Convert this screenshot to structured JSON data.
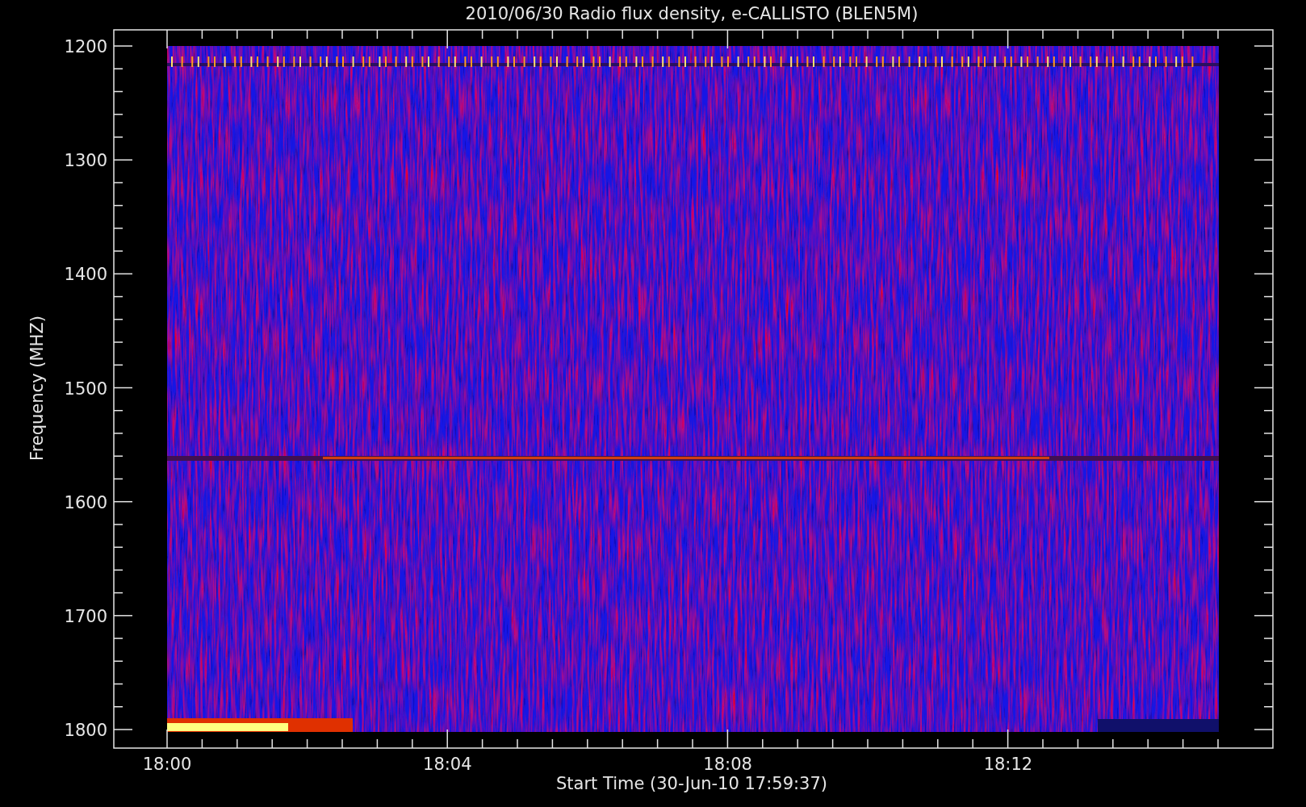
{
  "title": "2010/06/30  Radio flux density, e-CALLISTO (BLEN5M)",
  "ylabel": "Frequency (MHZ)",
  "xlabel": "Start Time (30-Jun-10 17:59:37)",
  "yticks": [
    "1200",
    "1300",
    "1400",
    "1500",
    "1600",
    "1700",
    "1800"
  ],
  "xticks": [
    "18:00",
    "18:04",
    "18:08",
    "18:12"
  ]
}
